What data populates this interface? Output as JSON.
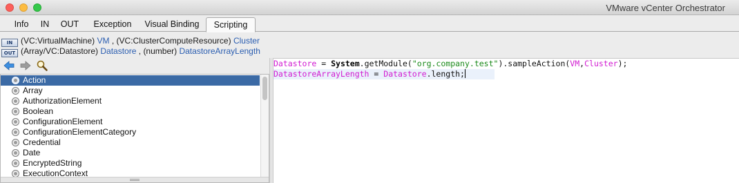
{
  "window": {
    "title": "VMware vCenter Orchestrator"
  },
  "tabs": [
    {
      "label": "Info"
    },
    {
      "label": "IN"
    },
    {
      "label": "OUT"
    },
    {
      "label": "Exception"
    },
    {
      "label": "Visual Binding"
    },
    {
      "label": "Scripting"
    }
  ],
  "active_tab": "Scripting",
  "bindings": {
    "in": {
      "icon": "IN",
      "param1_type": "(VC:VirtualMachine)",
      "param1_name": "VM",
      "separator": ",",
      "param2_type": "(VC:ClusterComputeResource)",
      "param2_name": "Cluster"
    },
    "out": {
      "icon": "OUT",
      "param1_type": "(Array/VC:Datastore)",
      "param1_name": "Datastore",
      "separator": ",",
      "param2_type": "(number)",
      "param2_name": "DatastoreArrayLength"
    }
  },
  "toolbar": {
    "back_icon": "back-arrow-icon",
    "forward_icon": "forward-arrow-icon",
    "search_icon": "search-icon"
  },
  "tree": {
    "selected": "Action",
    "items": [
      {
        "label": "Action"
      },
      {
        "label": "Array"
      },
      {
        "label": "AuthorizationElement"
      },
      {
        "label": "Boolean"
      },
      {
        "label": "ConfigurationElement"
      },
      {
        "label": "ConfigurationElementCategory"
      },
      {
        "label": "Credential"
      },
      {
        "label": "Date"
      },
      {
        "label": "EncryptedString"
      },
      {
        "label": "ExecutionContext"
      }
    ]
  },
  "script": {
    "line1": {
      "var1": "Datastore",
      "op1": " = ",
      "kw": "System",
      "call1": ".getModule(",
      "str": "\"org.company.test\"",
      "call2": ").sampleAction(",
      "arg1": "VM",
      "comma": ",",
      "arg2": "Cluster",
      "end": ");"
    },
    "line2": {
      "var1": "DatastoreArrayLength",
      "op1": " = ",
      "var2": "Datastore",
      "end": ".length;"
    }
  },
  "colors": {
    "selection": "#3b6aa5",
    "variable": "#d11ad1",
    "string": "#1a8a1a",
    "link": "#2a5db0"
  }
}
